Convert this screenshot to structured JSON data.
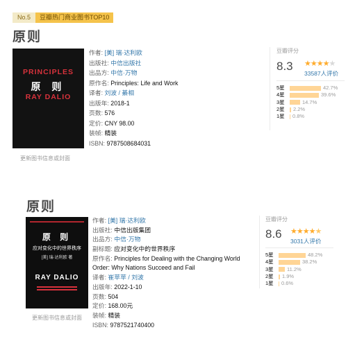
{
  "badge": {
    "rank": "No.5",
    "label": "豆瓣热门商业图书TOP10"
  },
  "book1": {
    "title": "原则",
    "cover": {
      "en_title": "PRINCIPLES",
      "cn_title": "原 则",
      "author": "RAY DALIO"
    },
    "cover_link": "更新图书信息或封面",
    "info": {
      "author_label": "作者:",
      "author": "[美] 瑞·达利欧",
      "publisher_label": "出版社:",
      "publisher": "中信出版社",
      "producer_label": "出品方:",
      "producer": "中信·万物",
      "original_label": "原作名:",
      "original": "Principles: Life and Work",
      "translator_label": "译者:",
      "translator": "刘波 / 綦相",
      "year_label": "出版年:",
      "year": "2018-1",
      "pages_label": "页数:",
      "pages": "576",
      "price_label": "定价:",
      "price": "CNY 98.00",
      "binding_label": "装帧:",
      "binding": "精装",
      "isbn_label": "ISBN:",
      "isbn": "9787508684031"
    },
    "rating": {
      "label": "豆瓣评分",
      "score": "8.3",
      "stars": 4,
      "count": "33587人评价",
      "dist": [
        {
          "star": "5星",
          "pct": "42.7%",
          "value": 42.7
        },
        {
          "star": "4星",
          "pct": "39.6%",
          "value": 39.6
        },
        {
          "star": "3星",
          "pct": "14.7%",
          "value": 14.7
        },
        {
          "star": "2星",
          "pct": "2.2%",
          "value": 2.2
        },
        {
          "star": "1星",
          "pct": "0.8%",
          "value": 0.8
        }
      ]
    }
  },
  "book2": {
    "title": "原则",
    "cover": {
      "title": "原 则",
      "subtitle": "应对变化中的世界秩序",
      "author_cn": "[美] 瑞·达利欧 著",
      "author_en": "RAY DALIO"
    },
    "cover_link": "更新图书信息或封面",
    "info": {
      "author_label": "作者:",
      "author": "[美] 瑞·达利欧",
      "publisher_label": "出版社:",
      "publisher": "中信出版集团",
      "producer_label": "出品方:",
      "producer": "中信·万物",
      "subtitle_label": "副标题:",
      "subtitle": "应对变化中的世界秩序",
      "original_label": "原作名:",
      "original": "Principles for Dealing with the Changing World",
      "original_cont": "Order: Why Nations Succeed and Fail",
      "translator_label": "译者:",
      "translator": "崔苹苹 / 刘波",
      "year_label": "出版年:",
      "year": "2022-1-10",
      "pages_label": "页数:",
      "pages": "504",
      "price_label": "定价:",
      "price": "168.00元",
      "binding_label": "装帧:",
      "binding": "精装",
      "isbn_label": "ISBN:",
      "isbn": "9787521740400"
    },
    "rating": {
      "label": "豆瓣评分",
      "score": "8.6",
      "stars": 4.5,
      "count": "3031人评价",
      "dist": [
        {
          "star": "5星",
          "pct": "48.2%",
          "value": 48.2
        },
        {
          "star": "4星",
          "pct": "38.2%",
          "value": 38.2
        },
        {
          "star": "3星",
          "pct": "11.2%",
          "value": 11.2
        },
        {
          "star": "2星",
          "pct": "1.9%",
          "value": 1.9
        },
        {
          "star": "1星",
          "pct": "0.6%",
          "value": 0.6
        }
      ]
    }
  }
}
